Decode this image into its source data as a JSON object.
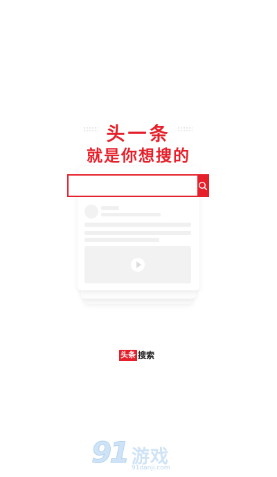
{
  "headline": {
    "line1": "头一条",
    "line2": "就是你想搜的"
  },
  "search": {
    "value": "",
    "placeholder": ""
  },
  "icons": {
    "search_button": "search-icon",
    "media": "play-icon"
  },
  "brand": {
    "badge": "头条",
    "text": "搜索"
  },
  "watermark": {
    "numeral": "91",
    "name": "游戏",
    "url": "91danji.com"
  },
  "colors": {
    "accent": "#e5202a",
    "skeleton": "#f0f0f0",
    "watermark": "#cfe3f7"
  }
}
